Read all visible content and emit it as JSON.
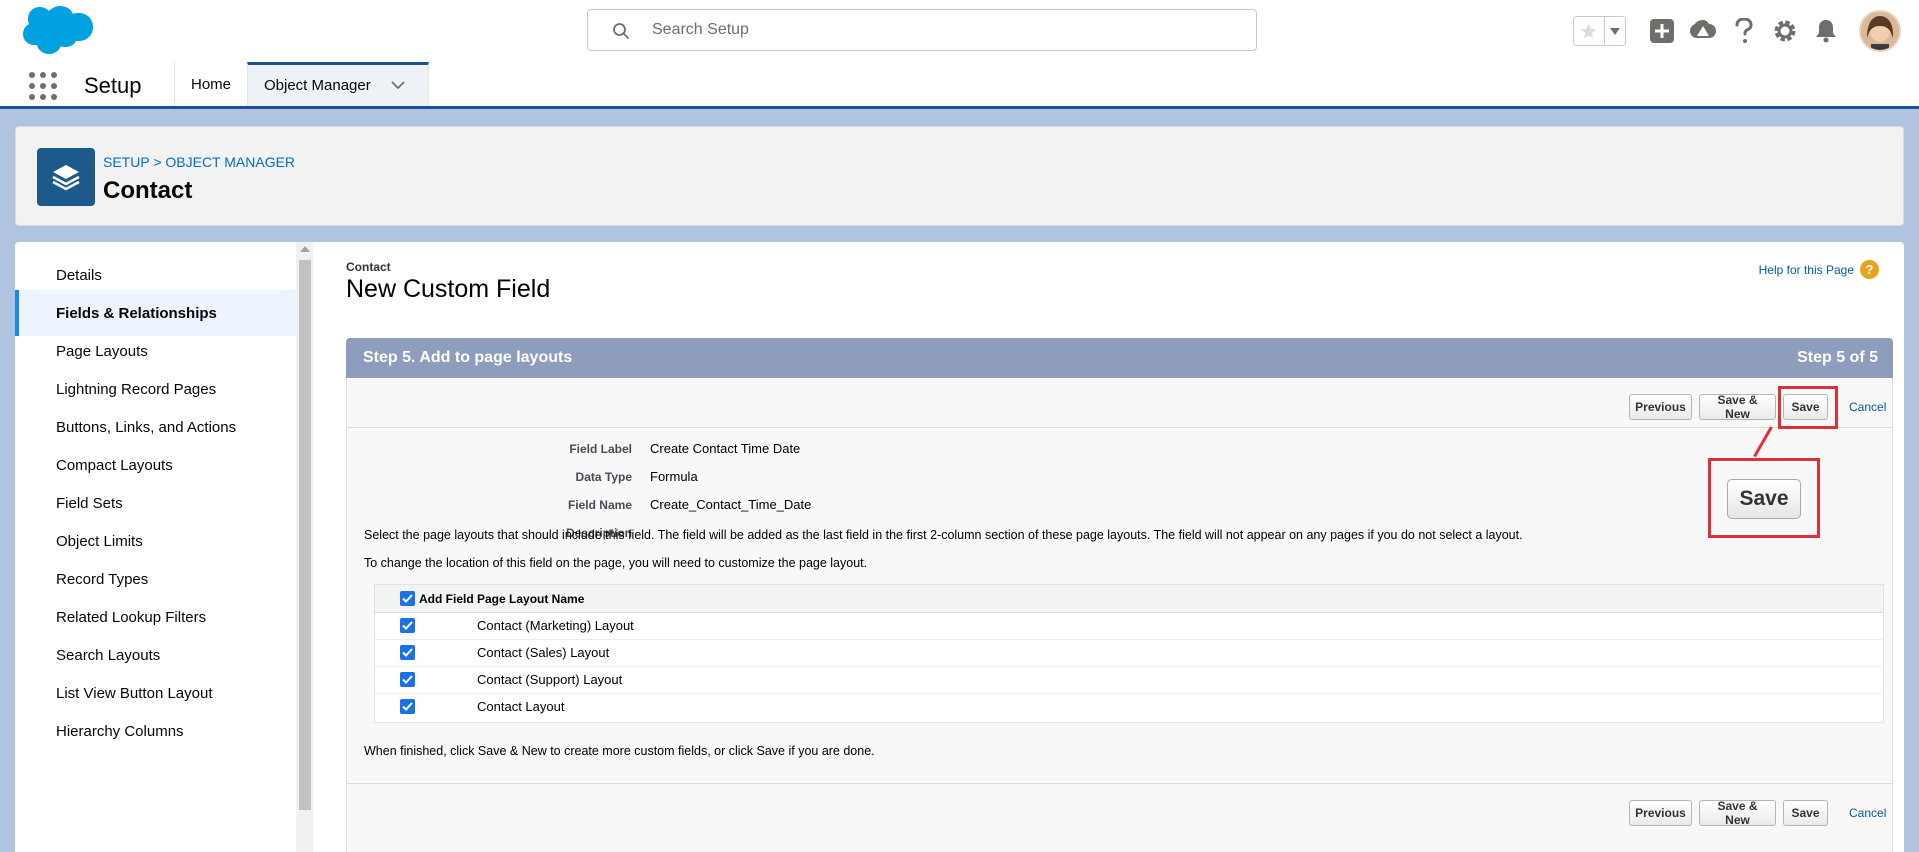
{
  "header": {
    "search_placeholder": "Search Setup"
  },
  "context_bar": {
    "app_name": "Setup",
    "tabs": [
      {
        "label": "Home"
      },
      {
        "label": "Object Manager"
      }
    ]
  },
  "page_header": {
    "breadcrumb": "SETUP > OBJECT MANAGER",
    "title": "Contact"
  },
  "sidebar": {
    "items": [
      {
        "label": "Details",
        "active": false
      },
      {
        "label": "Fields & Relationships",
        "active": true
      },
      {
        "label": "Page Layouts",
        "active": false
      },
      {
        "label": "Lightning Record Pages",
        "active": false
      },
      {
        "label": "Buttons, Links, and Actions",
        "active": false
      },
      {
        "label": "Compact Layouts",
        "active": false
      },
      {
        "label": "Field Sets",
        "active": false
      },
      {
        "label": "Object Limits",
        "active": false
      },
      {
        "label": "Record Types",
        "active": false
      },
      {
        "label": "Related Lookup Filters",
        "active": false
      },
      {
        "label": "Search Layouts",
        "active": false
      },
      {
        "label": "List View Button Layout",
        "active": false
      },
      {
        "label": "Hierarchy Columns",
        "active": false
      }
    ]
  },
  "content": {
    "object_name": "Contact",
    "title": "New Custom Field",
    "help_link": "Help for this Page",
    "step_title": "Step 5. Add to page layouts",
    "step_count": "Step 5 of 5",
    "buttons": {
      "previous": "Previous",
      "save_new": "Save & New",
      "save": "Save",
      "cancel": "Cancel"
    },
    "zoom_save_label": "Save",
    "details": [
      {
        "label": "Field Label",
        "value": "Create Contact Time Date"
      },
      {
        "label": "Data Type",
        "value": "Formula"
      },
      {
        "label": "Field Name",
        "value": "Create_Contact_Time_Date"
      },
      {
        "label": "Description",
        "value": ""
      }
    ],
    "instructions_1": "Select the page layouts that should include this field. The field will be added as the last field in the first 2-column section of these page layouts. The field will not appear on any pages if you do not select a layout.",
    "instructions_2": "To change the location of this field on the page, you will need to customize the page layout.",
    "table": {
      "col_add": "Add Field",
      "col_name": "Page Layout Name",
      "rows": [
        {
          "name": "Contact (Marketing) Layout",
          "checked": true
        },
        {
          "name": "Contact (Sales) Layout",
          "checked": true
        },
        {
          "name": "Contact (Support) Layout",
          "checked": true
        },
        {
          "name": "Contact Layout",
          "checked": true
        }
      ]
    },
    "finish_text": "When finished, click Save & New to create more custom fields, or click Save if you are done."
  },
  "colors": {
    "brand_blue": "#1b5297",
    "step_bar": "#8e9dbe",
    "link": "#015ba7",
    "highlight_red": "#e0303a",
    "checkbox_blue": "#1b72e8"
  }
}
